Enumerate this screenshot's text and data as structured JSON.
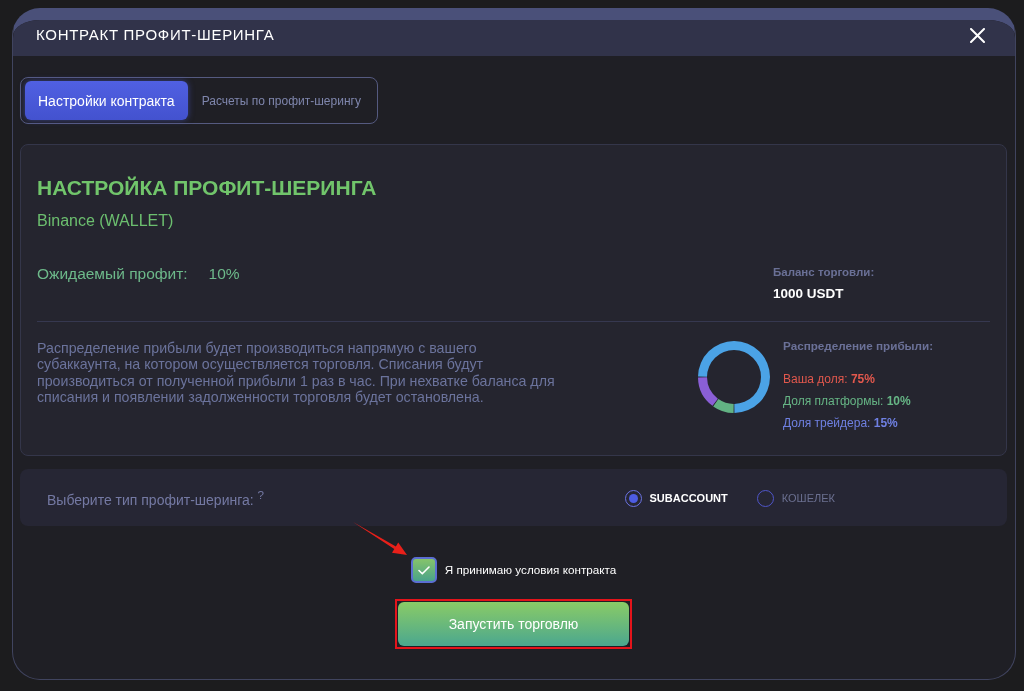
{
  "window": {
    "title": "КОНТРАКТ ПРОФИТ-ШЕРИНГА"
  },
  "tabs": [
    {
      "label": "Настройки контракта",
      "selected": true
    },
    {
      "label": "Расчеты по профит-шерингу",
      "selected": false
    }
  ],
  "settings": {
    "title": "НАСТРОЙКА ПРОФИТ-ШЕРИНГА",
    "exchange": "Binance (WALLET)",
    "expected_profit": {
      "label": "Ожидаемый профит:",
      "value": "10%"
    },
    "balance": {
      "label": "Баланс торговли:",
      "value": "1000 USDT"
    },
    "description": "Распределение прибыли будет производиться напрямую с вашего субаккаунта, на котором осуществляется торговля. Списания будут производиться от полученной прибыли 1 раз в час. При нехватке баланса для списания и появлении задолженности торговля будет остановлена.",
    "distribution": {
      "title": "Распределение прибыли:",
      "shares": [
        {
          "text": "Ваша доля: **75%**",
          "color": "#e2584d"
        },
        {
          "text": "Доля платформы: **10%**",
          "color": "#66b585"
        },
        {
          "text": "Доля трейдера: **15%**",
          "color": "#6f80e2"
        }
      ],
      "chart_data": {
        "type": "donut",
        "values": [
          75,
          10,
          15
        ],
        "colors": [
          "#4ba3e6",
          "#62b283",
          "#8a5fd6"
        ]
      }
    }
  },
  "sharing_type": {
    "label": "Выберите тип профит-шеринга: $^{?}$",
    "options": [
      {
        "label": "SUBACCOUNT",
        "selected": true
      },
      {
        "label": "КОШЕЛЕК",
        "selected": false
      }
    ]
  },
  "agreement": {
    "label": "Я принимаю условия контракта",
    "checked": true
  },
  "start_button": {
    "label": "Запустить торговлю"
  }
}
